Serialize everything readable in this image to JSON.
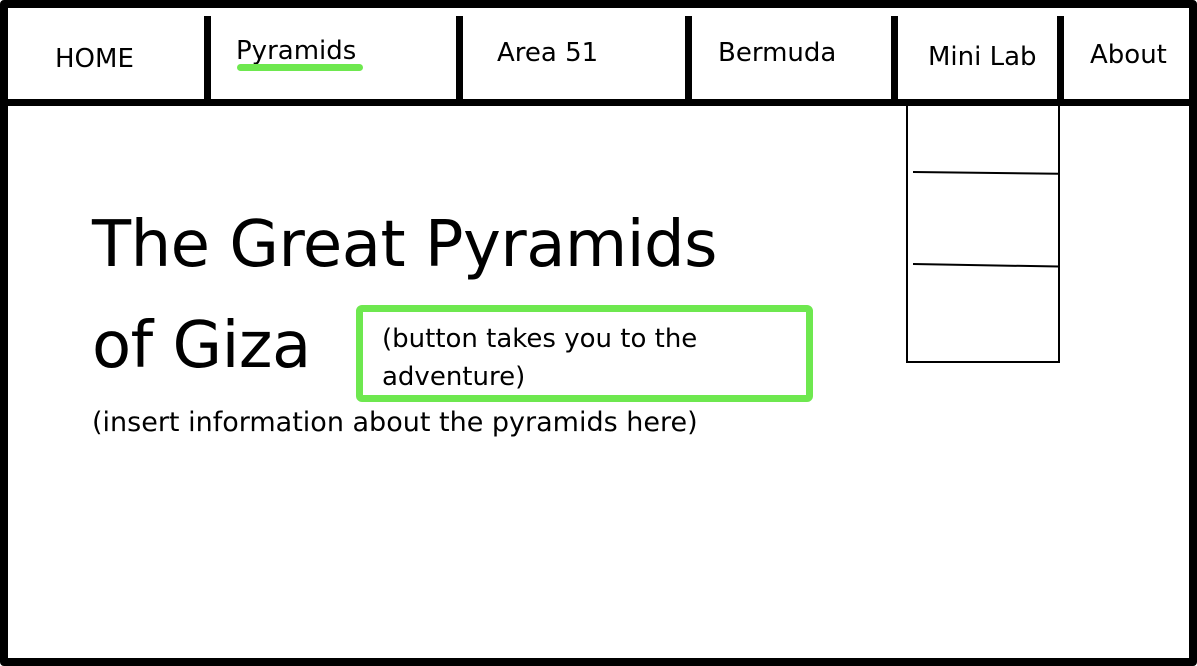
{
  "nav": {
    "items": [
      {
        "label": "HOME"
      },
      {
        "label": "Pyramids",
        "active": true
      },
      {
        "label": "Area 51"
      },
      {
        "label": "Bermuda"
      },
      {
        "label": "Mini Lab"
      },
      {
        "label": "About"
      }
    ]
  },
  "main": {
    "title_line1": "The Great Pyramids",
    "title_line2": "of Giza",
    "button_label": "(button takes you to the adventure)",
    "info_text": "(insert information about the pyramids here)"
  },
  "colors": {
    "highlight": "#6ee84f",
    "ink": "#000000",
    "background": "#ffffff"
  }
}
